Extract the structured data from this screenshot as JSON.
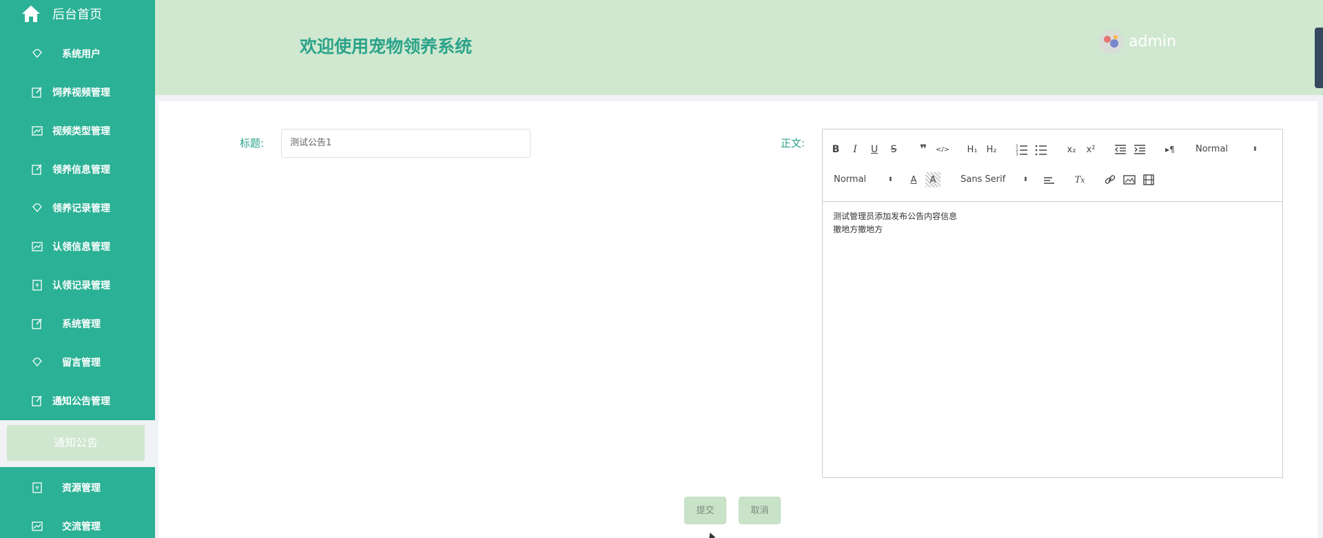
{
  "sidebar": {
    "home_label": "后台首页",
    "items": [
      {
        "label": "系统用户",
        "icon": "diamond-icon"
      },
      {
        "label": "饲养视频管理",
        "icon": "edit-icon"
      },
      {
        "label": "视频类型管理",
        "icon": "chart-icon"
      },
      {
        "label": "领养信息管理",
        "icon": "edit-icon"
      },
      {
        "label": "领养记录管理",
        "icon": "diamond-icon"
      },
      {
        "label": "认领信息管理",
        "icon": "chart-icon"
      },
      {
        "label": "认领记录管理",
        "icon": "money-icon"
      },
      {
        "label": "系统管理",
        "icon": "edit-icon"
      },
      {
        "label": "留言管理",
        "icon": "diamond-icon"
      },
      {
        "label": "通知公告管理",
        "icon": "edit-icon"
      },
      {
        "label": "资源管理",
        "icon": "money-icon"
      },
      {
        "label": "交流管理",
        "icon": "chart-icon"
      }
    ],
    "active_sub": "通知公告"
  },
  "header": {
    "title": "欢迎使用宠物领养系统",
    "username": "admin"
  },
  "form": {
    "title_label": "标题:",
    "title_value": "测试公告1",
    "body_label": "正文:"
  },
  "editor": {
    "header_select": "Normal",
    "size_select": "Normal",
    "font_select": "Sans Serif",
    "content_lines": [
      "测试管理员添加发布公告内容信息",
      "撤地方撤地方"
    ]
  },
  "buttons": {
    "submit": "提交",
    "cancel": "取消"
  },
  "colors": {
    "sidebar": "#2bb195",
    "header": "#d0e8d0",
    "accent": "#2ba38a"
  }
}
